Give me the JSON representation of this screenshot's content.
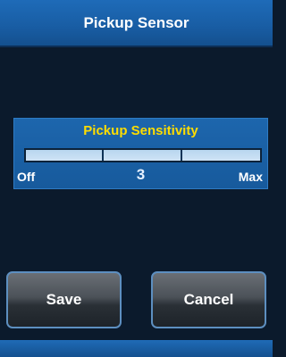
{
  "header": {
    "title": "Pickup Sensor"
  },
  "sensitivity": {
    "title": "Pickup Sensitivity",
    "value": "3",
    "min_label": "Off",
    "max_label": "Max",
    "level_fraction": 1.0
  },
  "buttons": {
    "save_label": "Save",
    "cancel_label": "Cancel"
  },
  "colors": {
    "accent_title": "#ffdd00",
    "header_blue": "#195ea5",
    "background": "#0b1a2c"
  }
}
